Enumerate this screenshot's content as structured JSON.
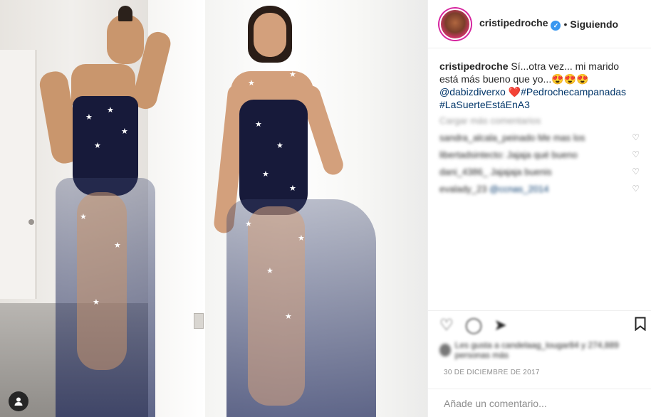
{
  "header": {
    "username": "cristipedroche",
    "verified": "✓",
    "separator": "•",
    "follow_state": "Siguiendo"
  },
  "caption": {
    "username": "cristipedroche",
    "text": "Sí...otra vez... mi marido está más bueno que yo...",
    "emojis": "😍😍😍",
    "mention": "@dabizdiverxo",
    "heart": "❤️",
    "hashtag1": "#Pedrochecampanadas",
    "hashtag2": "#LaSuerteEstáEnA3"
  },
  "load_more": "Cargar más comentarios",
  "comments": [
    {
      "text": "sandra_alcala_peinado Me mas los",
      "mention": ""
    },
    {
      "text": "libertadsintecto: Jajaja qué bueno",
      "mention": ""
    },
    {
      "text": "dani_4386_ Jajajaja buenis",
      "mention": ""
    },
    {
      "text": "evalady_23 ",
      "mention": "@ccnas_2014"
    }
  ],
  "actions": {
    "like": "♡",
    "comment": "◯",
    "share": "➤",
    "save": "🔖"
  },
  "likes_text": "Les gusta a candelaag_lougar84 y 274,889 personas más",
  "date": "30 DE DICIEMBRE DE 2017",
  "add_comment_placeholder": "Añade un comentario...",
  "icons": [
    "verified-icon",
    "heart-icon",
    "comment-icon",
    "share-icon",
    "bookmark-icon",
    "user-tag-icon"
  ],
  "colors": {
    "link": "#003569",
    "verified": "#3897f0",
    "muted": "#8e8e8e"
  }
}
